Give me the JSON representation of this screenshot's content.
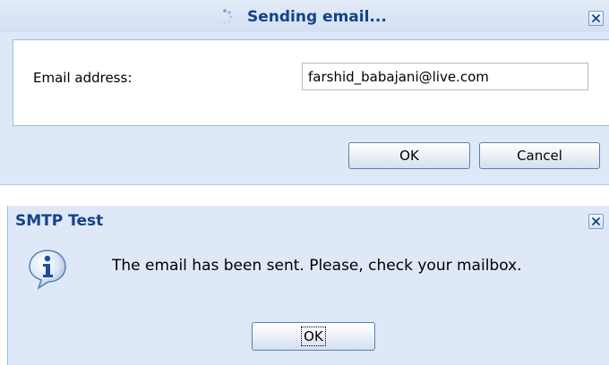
{
  "sending_dialog": {
    "title": "Sending email...",
    "email_label": "Email address:",
    "email_value": "farshid_babajani@live.com",
    "ok_label": "OK",
    "cancel_label": "Cancel",
    "close_icon": "close-icon",
    "spinner_icon": "loading-spinner-icon"
  },
  "result_dialog": {
    "title": "SMTP Test",
    "message": "The email has been sent. Please, check your mailbox.",
    "ok_label": "OK",
    "info_icon": "info-icon",
    "close_icon": "close-icon"
  }
}
